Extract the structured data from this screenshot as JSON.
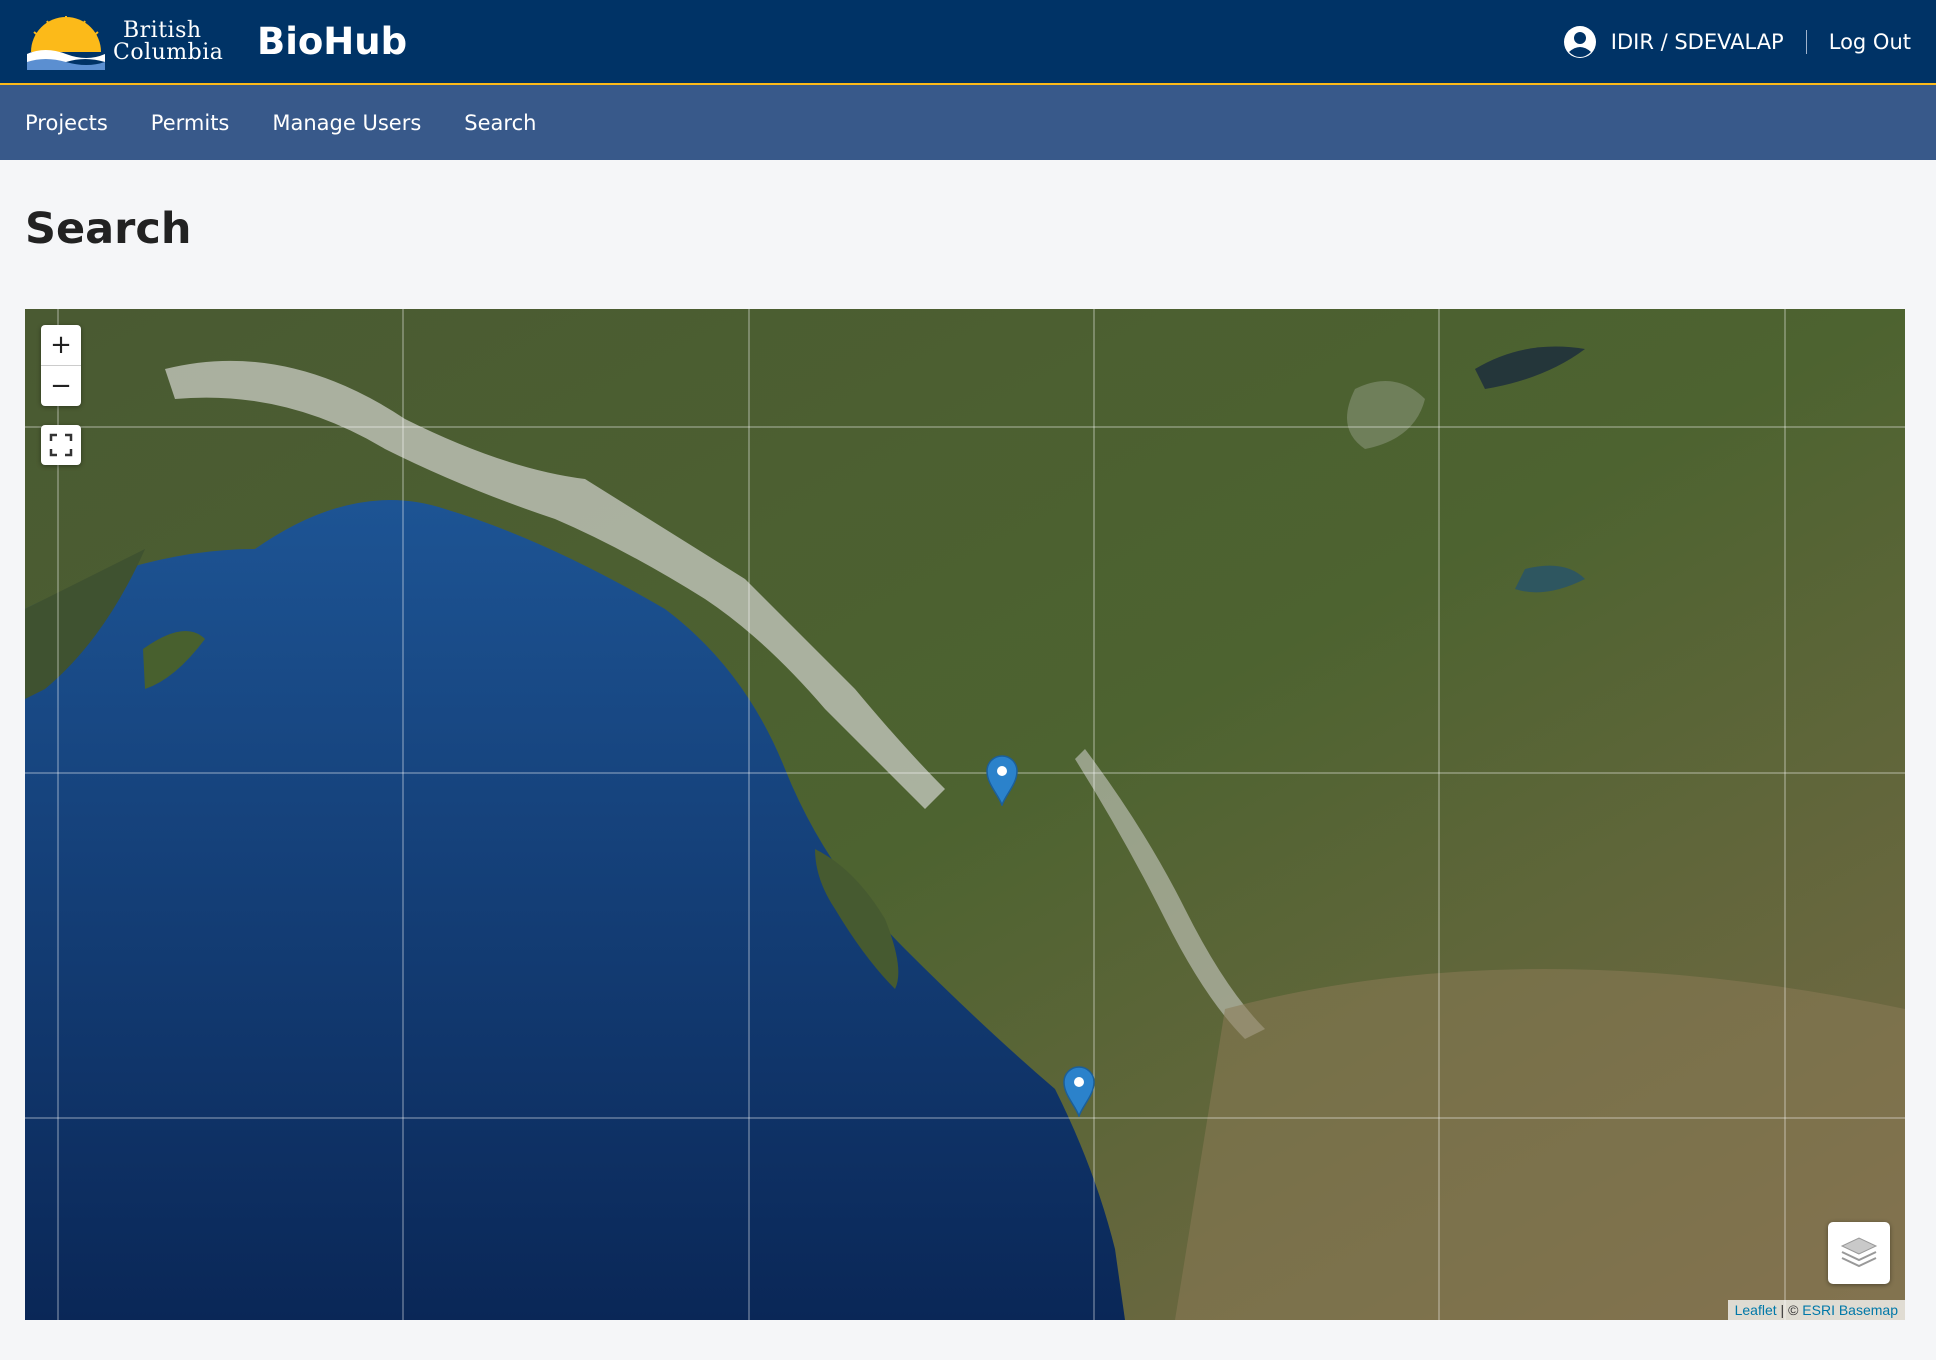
{
  "header": {
    "logo_line1": "British",
    "logo_line2": "Columbia",
    "app_title": "BioHub",
    "user_label": "IDIR / SDEVALAP",
    "logout_label": "Log Out"
  },
  "nav": {
    "items": [
      {
        "label": "Projects"
      },
      {
        "label": "Permits"
      },
      {
        "label": "Manage Users"
      },
      {
        "label": "Search"
      }
    ]
  },
  "page": {
    "title": "Search"
  },
  "map": {
    "zoom_in_label": "+",
    "zoom_out_label": "−",
    "attribution": {
      "leaflet": "Leaflet",
      "separator": " | © ",
      "basemap": "ESRI Basemap"
    },
    "marker_count": 2,
    "colors": {
      "marker": "#2b82cb",
      "header_bg": "#003366",
      "nav_bg": "#38598a",
      "accent": "#fcba19"
    }
  }
}
